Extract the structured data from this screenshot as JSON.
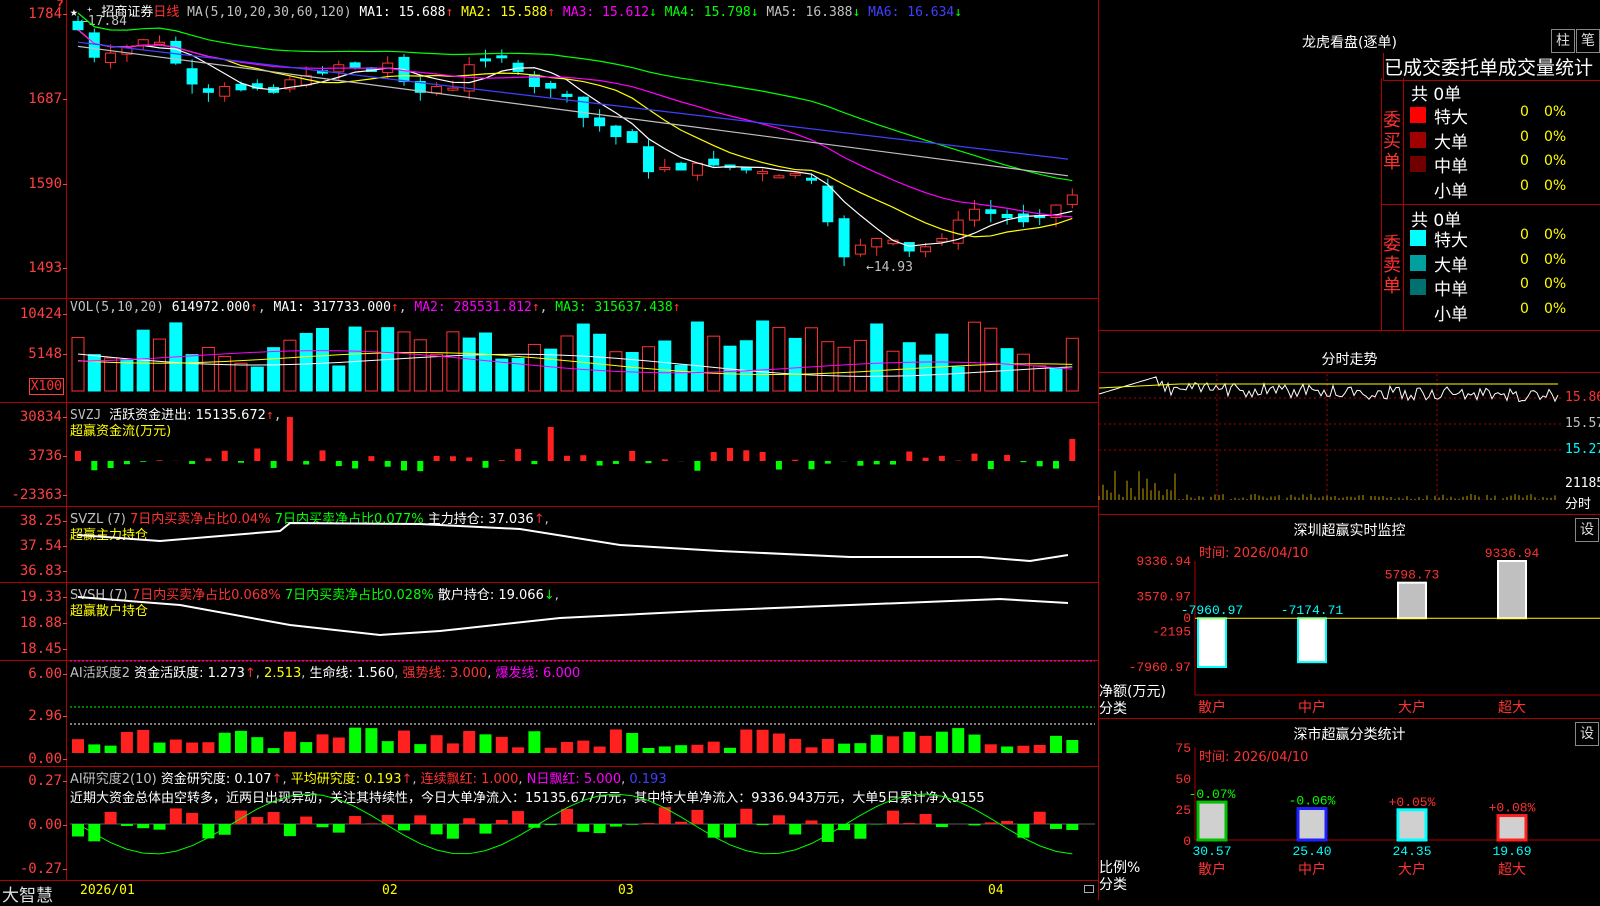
{
  "stock": {
    "name": "招商证券",
    "period": "日线"
  },
  "main": {
    "ma_header": "MA(5,10,20,30,60,120)",
    "ma": [
      {
        "label": "MA1: 15.688",
        "arrow": "↑",
        "color": "#ffffff"
      },
      {
        "label": "MA2: 15.588",
        "arrow": "↑",
        "color": "#ffff00"
      },
      {
        "label": "MA3: 15.612",
        "arrow": "↓",
        "color": "#ff00ff"
      },
      {
        "label": "MA4: 15.798",
        "arrow": "↓",
        "color": "#00ff00"
      },
      {
        "label": "MA5: 16.388",
        "arrow": "↓",
        "color": "#c0c0c0"
      },
      {
        "label": "MA6: 16.634",
        "arrow": "↓",
        "color": "#4040ff"
      }
    ],
    "yticks": [
      "1784",
      "1687",
      "1590",
      "1493"
    ],
    "high_label": "←17.84",
    "low_label": "←14.93"
  },
  "vol": {
    "header": "VOL(5,10,20)",
    "value": "614972.000",
    "ma": [
      {
        "label": "MA1: 317733.000",
        "color": "#ffffff"
      },
      {
        "label": "MA2: 285531.812",
        "color": "#ff00ff"
      },
      {
        "label": "MA3: 315637.438",
        "color": "#00ff00"
      }
    ],
    "yticks": [
      "10424",
      "5148"
    ],
    "unit": "X100"
  },
  "svzj": {
    "header": "SVZJ",
    "line": "活跃资金进出: 15135.672",
    "subtitle": "超赢资金流(万元)",
    "yticks": [
      "30834",
      "3736",
      "-23363"
    ]
  },
  "svzl": {
    "header": "SVZL (7)",
    "a": "7日内买卖净占比0.04%",
    "b": "7日内买卖净占比0.077%",
    "c": "主力持仓: 37.036",
    "subtitle": "超赢主力持仓",
    "yticks": [
      "38.25",
      "37.54",
      "36.83"
    ]
  },
  "svsh": {
    "header": "SVSH (7)",
    "a": "7日内买卖净占比0.068%",
    "b": "7日内买卖净占比0.028%",
    "c": "散户持仓: 19.066",
    "subtitle": "超赢散户持仓",
    "yticks": [
      "19.33",
      "18.88",
      "18.45"
    ]
  },
  "ai1": {
    "header": "AI活跃度2",
    "a": "资金活跃度: 1.273",
    "b": "2.513",
    "c": "生命线: 1.560",
    "d": "强势线: 3.000",
    "e": "爆发线: 6.000",
    "yticks": [
      "6.00",
      "2.96",
      "0.00"
    ]
  },
  "ai2": {
    "header": "AI研究度2(10)",
    "a": "资金研究度: 0.107",
    "b": "平均研究度: 0.193",
    "c": "连续飘红: 1.000",
    "d": "N日飘红: 5.000",
    "e": "0.193",
    "comment": "近期大资金总体由空转多，近两日出现异动，关注其持续性，今日大单净流入：15135.677万元，其中特大单净流入：9336.943万元，大单5日累计净入9155",
    "yticks": [
      "0.27",
      "0.00",
      "-0.27"
    ]
  },
  "xaxis": {
    "brand": "大智慧",
    "labels": [
      "2026/01",
      "02",
      "03",
      "04"
    ]
  },
  "dragon": {
    "title": "龙虎看盘(逐单)",
    "btn_a": "柱",
    "btn_b": "笔",
    "tabs": "已成交委托单成交量统计",
    "buy_label": "委买单",
    "sell_label": "委卖单",
    "buy_total": "共 0单",
    "sell_total": "共 0单",
    "buy_rows": [
      {
        "name": "特大",
        "count": "0",
        "pct": "0%",
        "color": "#ff0000"
      },
      {
        "name": "大单",
        "count": "0",
        "pct": "0%",
        "color": "#a00000"
      },
      {
        "name": "中单",
        "count": "0",
        "pct": "0%",
        "color": "#700000"
      },
      {
        "name": "小单",
        "count": "0",
        "pct": "0%",
        "color": "#000000"
      }
    ],
    "sell_rows": [
      {
        "name": "特大",
        "count": "0",
        "pct": "0%",
        "color": "#00ffff"
      },
      {
        "name": "大单",
        "count": "0",
        "pct": "0%",
        "color": "#00a0a0"
      },
      {
        "name": "中单",
        "count": "0",
        "pct": "0%",
        "color": "#007070"
      },
      {
        "name": "小单",
        "count": "0",
        "pct": "0%",
        "color": "#000000"
      }
    ]
  },
  "intraday": {
    "title": "分时走势",
    "yticks": [
      "15.86",
      "15.57",
      "15.27"
    ],
    "vol_tick": "21185",
    "vol_unit": "分时"
  },
  "monitor": {
    "title": "深圳超赢实时监控",
    "btn": "设",
    "time": "时间: 2026/04/10",
    "ylabel": "净额(万元)",
    "xlabel": "分类",
    "yticks": [
      "9336.94",
      "3570.97",
      "0",
      "-2195",
      "-7960.97"
    ],
    "chart_data": {
      "type": "bar",
      "categories": [
        "散户",
        "中户",
        "大户",
        "超大"
      ],
      "values": [
        -7960.97,
        -7174.71,
        5798.73,
        9336.94
      ],
      "value_labels": [
        "-7960.97",
        "-7174.71",
        "5798.73",
        "9336.94"
      ],
      "ylim": [
        -7960.97,
        9336.94
      ]
    }
  },
  "classify": {
    "title": "深市超赢分类统计",
    "btn": "设",
    "time": "时间: 2026/04/10",
    "ylabel": "比例%",
    "xlabel": "分类",
    "yticks": [
      "75",
      "50",
      "25",
      "0"
    ],
    "chart_data": {
      "type": "bar",
      "categories": [
        "散户",
        "中户",
        "大户",
        "超大"
      ],
      "values": [
        30.57,
        25.4,
        24.35,
        19.69
      ],
      "value_labels": [
        "30.57",
        "25.40",
        "24.35",
        "19.69"
      ],
      "changes": [
        "-0.07%",
        "-0.06%",
        "+0.05%",
        "+0.08%"
      ],
      "colors": [
        "#00c000",
        "#2020ff",
        "#00ffff",
        "#ff2020"
      ],
      "ylim": [
        0,
        75
      ]
    }
  }
}
